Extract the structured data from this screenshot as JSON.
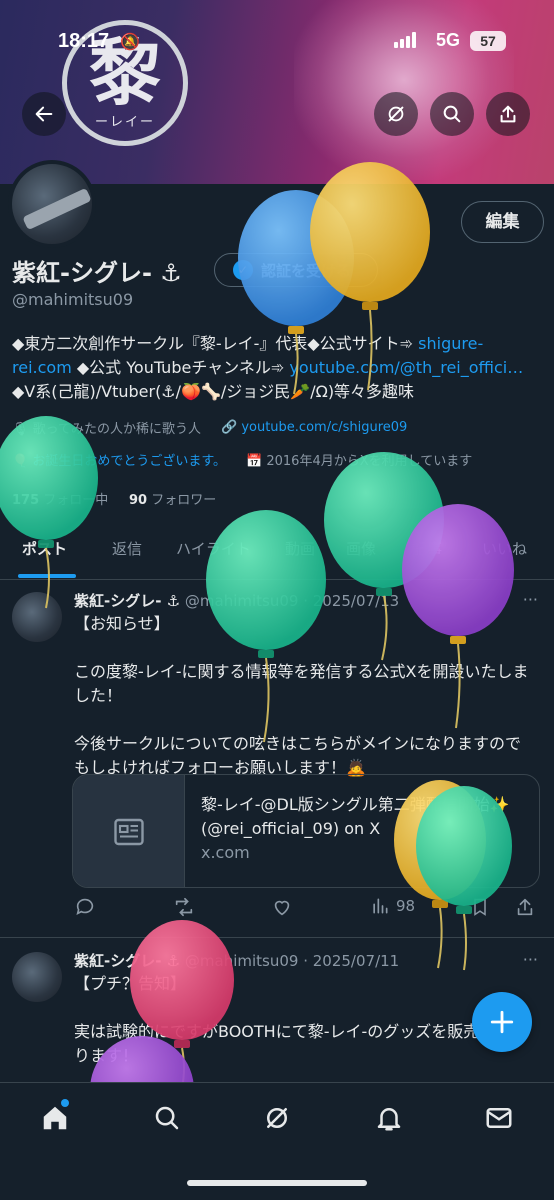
{
  "status_bar": {
    "time": "18:17",
    "network": "5G",
    "battery": "57"
  },
  "banner": {
    "emblem_kanji": "黎",
    "emblem_reading": "ーレイー"
  },
  "header_buttons": {
    "back_icon": "arrow-left-icon",
    "grok_icon": "grok-icon",
    "search_icon": "search-icon",
    "share_icon": "share-icon"
  },
  "profile": {
    "edit_label": "編集",
    "name": "紫紅-シグレ- ⚓",
    "verify_label": "認証を受ける",
    "handle": "@mahimitsu09",
    "bio_line1_a": "◆東方二次創作サークル『黎-レイ-』代表◆公式サイト➾ ",
    "bio_link1": "shigure-rei.com",
    "bio_line2_a": " ◆公式 YouTubeチャンネル➾ ",
    "bio_link2": "youtube.com/@th_rei_offici…",
    "bio_line3": "◆V系(己龍)/Vtuber(⚓/🍑🦴/ジョジ民🥕/Ω)等々多趣味",
    "meta_category": "歌ってみたの人か稀に歌う人",
    "meta_link": "youtube.com/c/shigure09",
    "meta_birthday": "お誕生日おめでとうございます。",
    "meta_joined": "2016年4月からXを利用しています",
    "following_count": "175",
    "following_label": "フォロー中",
    "followers_count": "90",
    "followers_label": "フォロワー"
  },
  "tabs": [
    "ポスト",
    "返信",
    "ハイライト",
    "動画",
    "画像",
    "記事",
    "いいね"
  ],
  "posts": [
    {
      "name": "紫紅-シグレ- ⚓",
      "handle_date": "@mahimitsu09 · 2025/07/13",
      "body": "【お知らせ】\n\nこの度黎-レイ-に関する情報等を発信する公式Xを開設いたしました！\n\n今後サークルについての呟きはこちらがメインになりますのでもしよければフォローお願いします！🙇",
      "card_title": "黎-レイ-@DL版シングル第二弾配信開始✨ (@rei_official_09) on X",
      "card_domain": "x.com",
      "views": "98"
    },
    {
      "name": "紫紅-シグレ- ⚓",
      "handle_date": "@mahimitsu09 · 2025/07/11",
      "body": "【プチ？告知】\n\n実は試験的にですがBOOTHにて黎-レイ-のグッズを販売しております！"
    }
  ],
  "more_glyph": "···",
  "fab_icon": "compose-plus-icon",
  "bottom_nav": [
    "home-icon",
    "search-icon",
    "grok-icon",
    "notifications-icon",
    "messages-icon"
  ],
  "colors": {
    "background": "#15202b",
    "accent": "#1d9bf0",
    "secondary_text": "#8b98a5",
    "border": "#38444d"
  }
}
